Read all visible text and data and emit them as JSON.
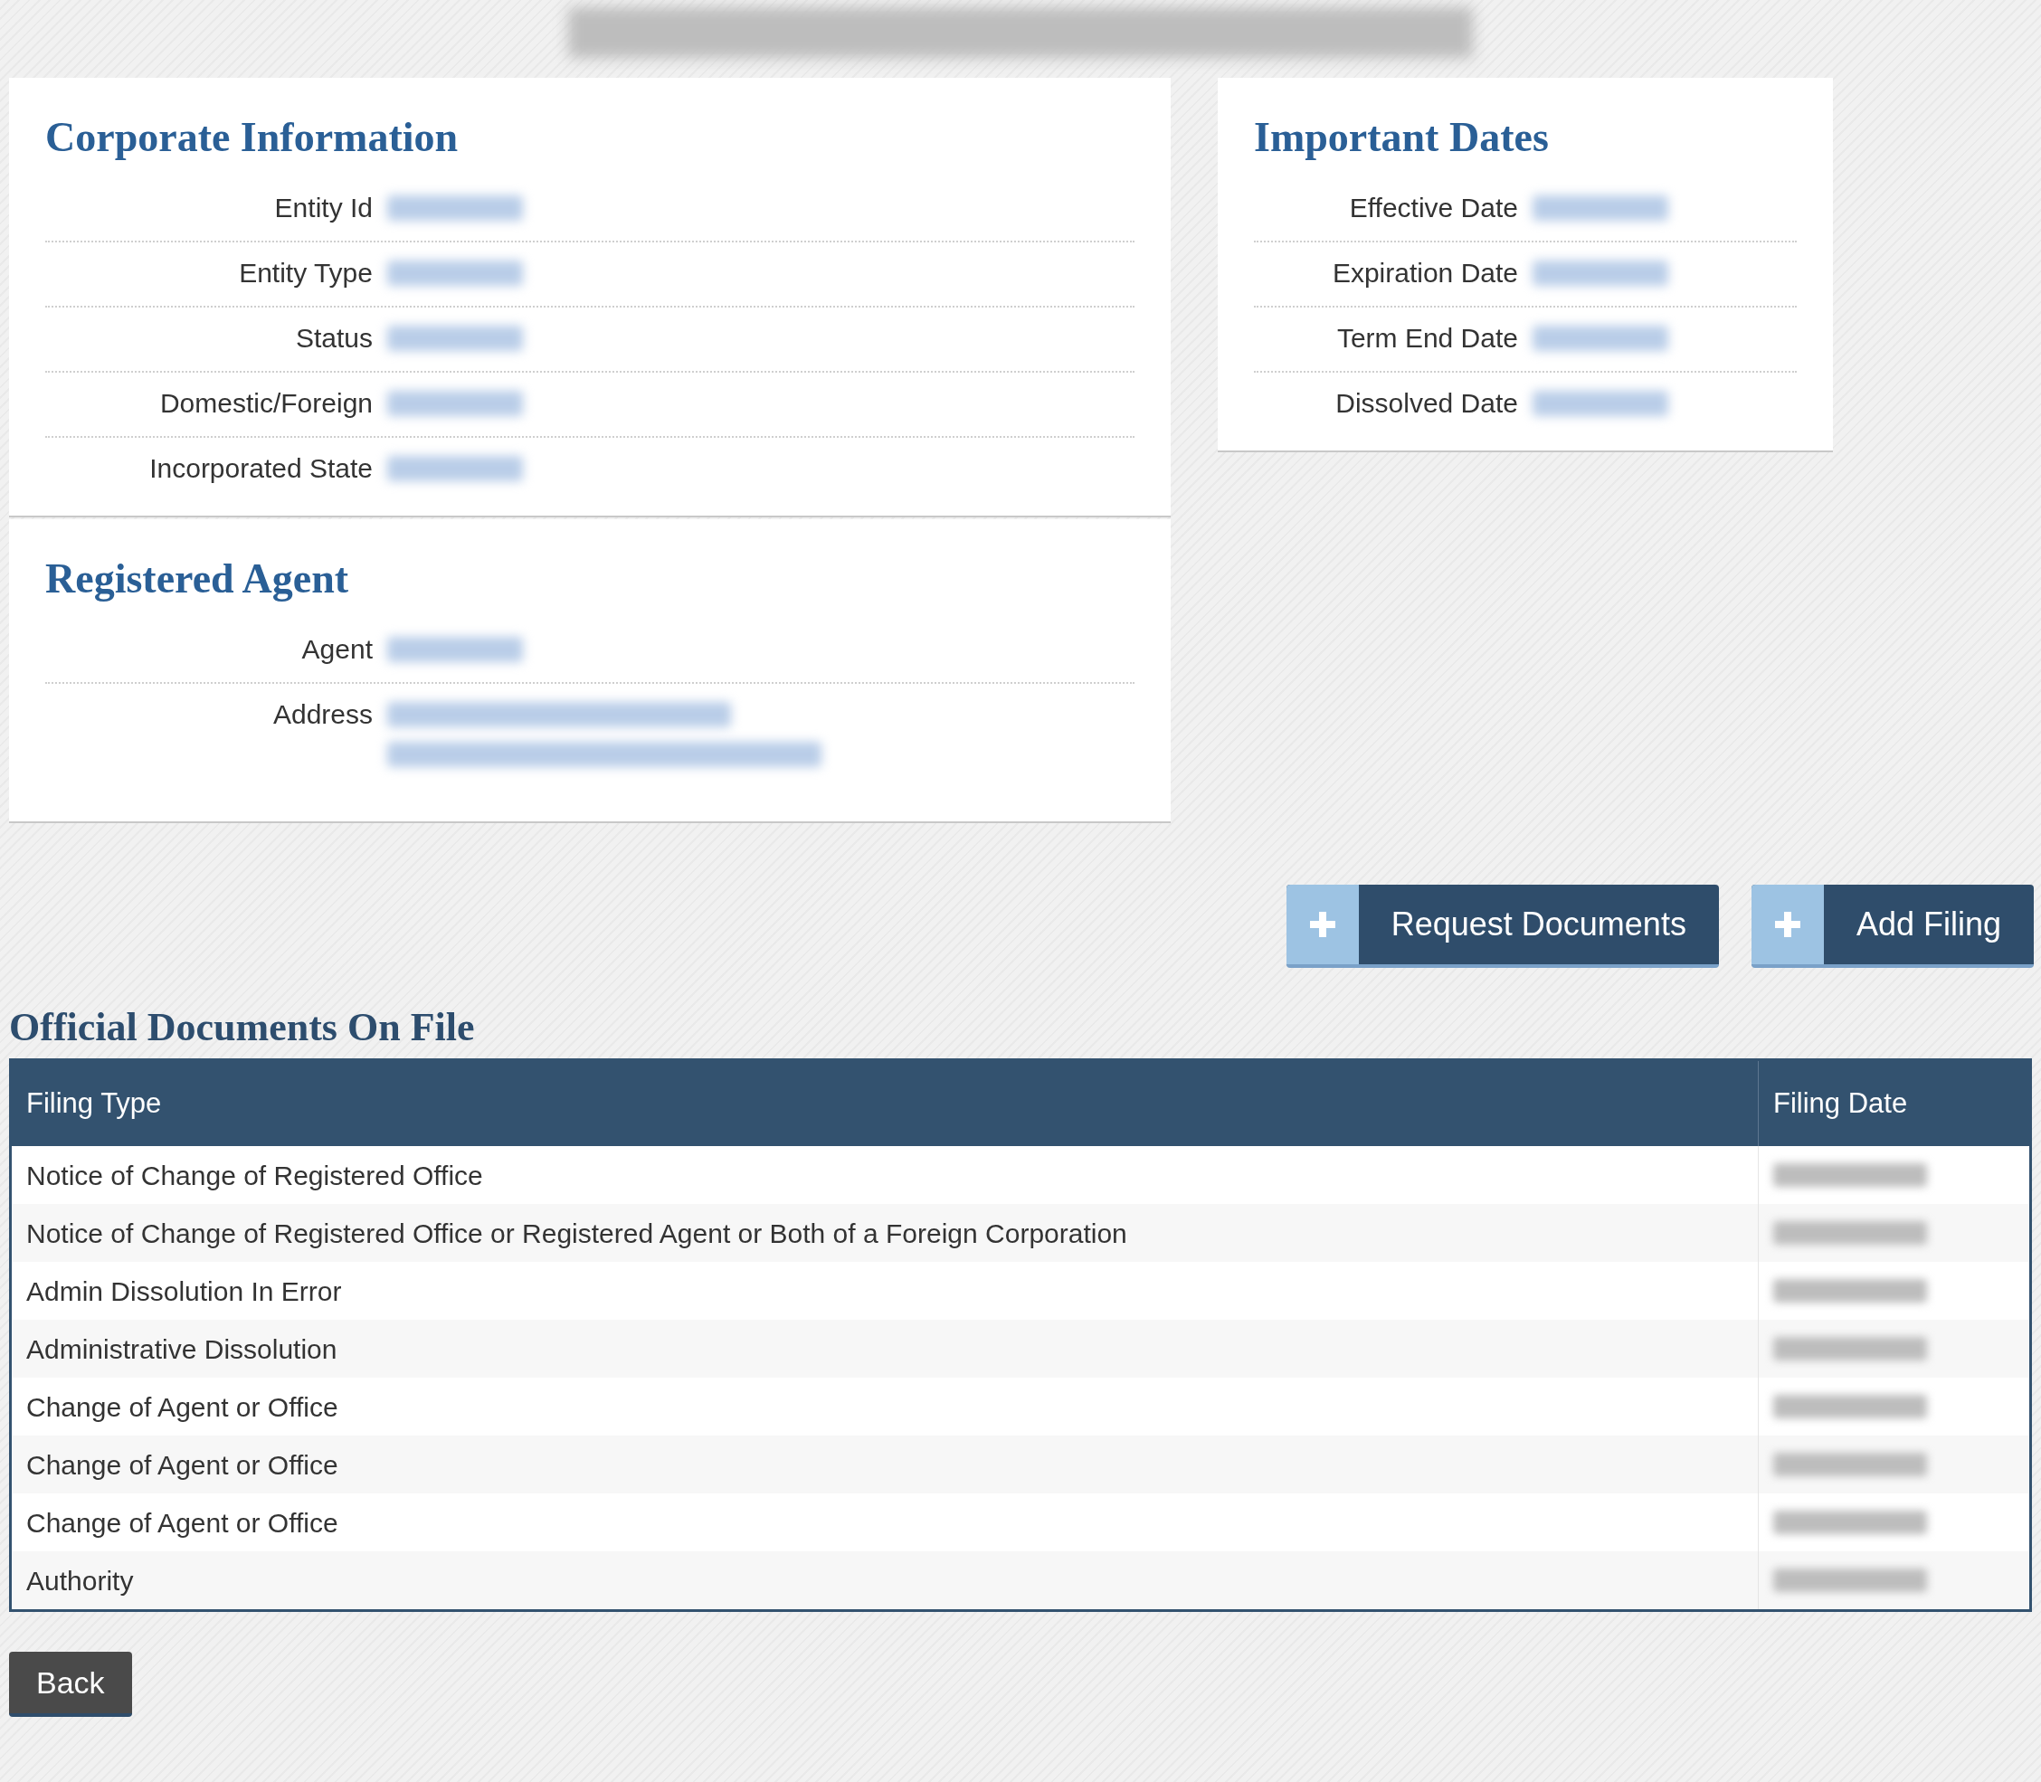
{
  "corporate_information": {
    "title": "Corporate Information",
    "fields": [
      {
        "label": "Entity Id",
        "kind": "single"
      },
      {
        "label": "Entity Type",
        "kind": "single"
      },
      {
        "label": "Status",
        "kind": "single"
      },
      {
        "label": "Domestic/Foreign",
        "kind": "single"
      },
      {
        "label": "Incorporated State",
        "kind": "single"
      }
    ]
  },
  "registered_agent": {
    "title": "Registered Agent",
    "fields": [
      {
        "label": "Agent",
        "kind": "single"
      },
      {
        "label": "Address",
        "kind": "multiline"
      }
    ]
  },
  "important_dates": {
    "title": "Important Dates",
    "fields": [
      {
        "label": "Effective Date",
        "kind": "single"
      },
      {
        "label": "Expiration Date",
        "kind": "single"
      },
      {
        "label": "Term End Date",
        "kind": "single"
      },
      {
        "label": "Dissolved Date",
        "kind": "single"
      }
    ]
  },
  "actions": [
    "Request Documents",
    "Add Filing"
  ],
  "documents": {
    "title": "Official Documents On File",
    "columns": [
      "Filing Type",
      "Filing Date"
    ],
    "rows": [
      {
        "filing_type": "Notice of Change of Registered Office"
      },
      {
        "filing_type": "Notice of Change of Registered Office or Registered Agent or Both of a Foreign Corporation"
      },
      {
        "filing_type": "Admin Dissolution In Error"
      },
      {
        "filing_type": "Administrative Dissolution"
      },
      {
        "filing_type": "Change of Agent or Office"
      },
      {
        "filing_type": "Change of Agent or Office"
      },
      {
        "filing_type": "Change of Agent or Office"
      },
      {
        "filing_type": "Authority"
      }
    ]
  },
  "back_button": "Back"
}
